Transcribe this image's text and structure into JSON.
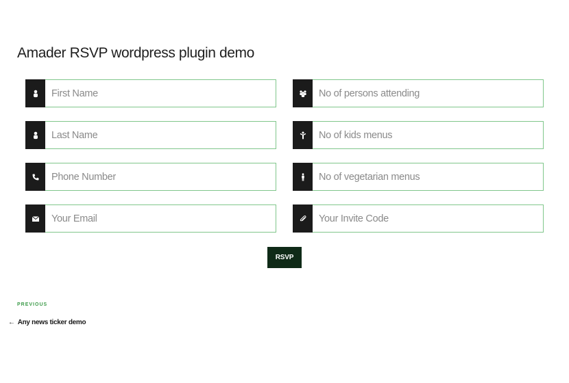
{
  "page": {
    "title": "Amader RSVP wordpress plugin demo"
  },
  "form": {
    "left_fields": [
      {
        "icon": "user-icon",
        "placeholder": "First Name"
      },
      {
        "icon": "user-icon",
        "placeholder": "Last Name"
      },
      {
        "icon": "phone-icon",
        "placeholder": "Phone Number"
      },
      {
        "icon": "envelope-icon",
        "placeholder": "Your Email"
      }
    ],
    "right_fields": [
      {
        "icon": "group-icon",
        "placeholder": "No of persons attending"
      },
      {
        "icon": "child-icon",
        "placeholder": "No of kids menus"
      },
      {
        "icon": "person-icon",
        "placeholder": "No of vegetarian menus"
      },
      {
        "icon": "paperclip-icon",
        "placeholder": "Your Invite Code"
      }
    ],
    "submit_label": "RSVP"
  },
  "post_nav": {
    "previous_label": "PREVIOUS",
    "previous_arrow": "←",
    "previous_link": "Any news ticker demo"
  },
  "colors": {
    "accent_green": "#3b9a48",
    "input_border": "#7fc68a",
    "icon_bg": "#1b1b1b",
    "button_bg": "#0f2a17"
  }
}
